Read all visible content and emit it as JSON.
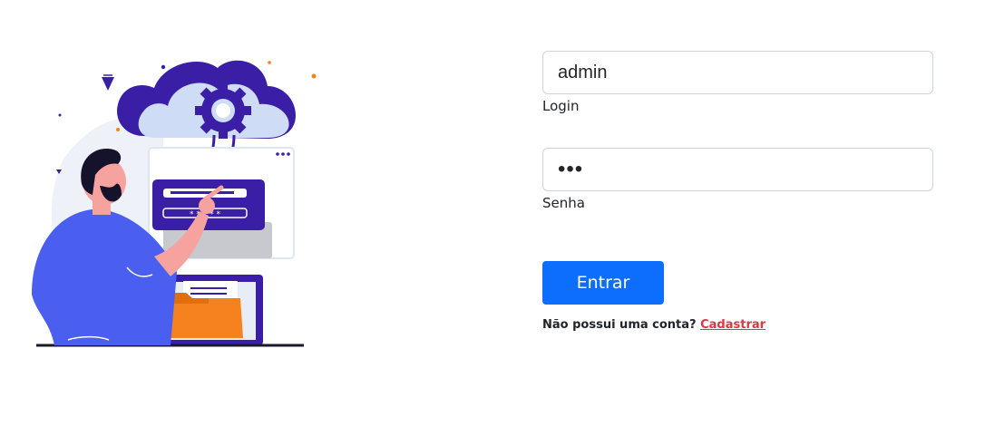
{
  "login_form": {
    "username_value": "admin",
    "username_label": "Login",
    "password_value": "•••",
    "password_label": "Senha",
    "submit_label": "Entrar",
    "signup_prompt": "Não possui uma conta?",
    "signup_link": "Cadastrar"
  },
  "illustration": {
    "icon": "person-cloud-login-illustration",
    "colors": {
      "primary_purple": "#3b1ea6",
      "cloud": "#cfdcf5",
      "shirt": "#4a5ff0",
      "folder": "#f5821f",
      "skin": "#f6a29e"
    }
  },
  "colors": {
    "button_bg": "#0d6efd",
    "link": "#dc3545",
    "input_border": "#ced4da"
  }
}
